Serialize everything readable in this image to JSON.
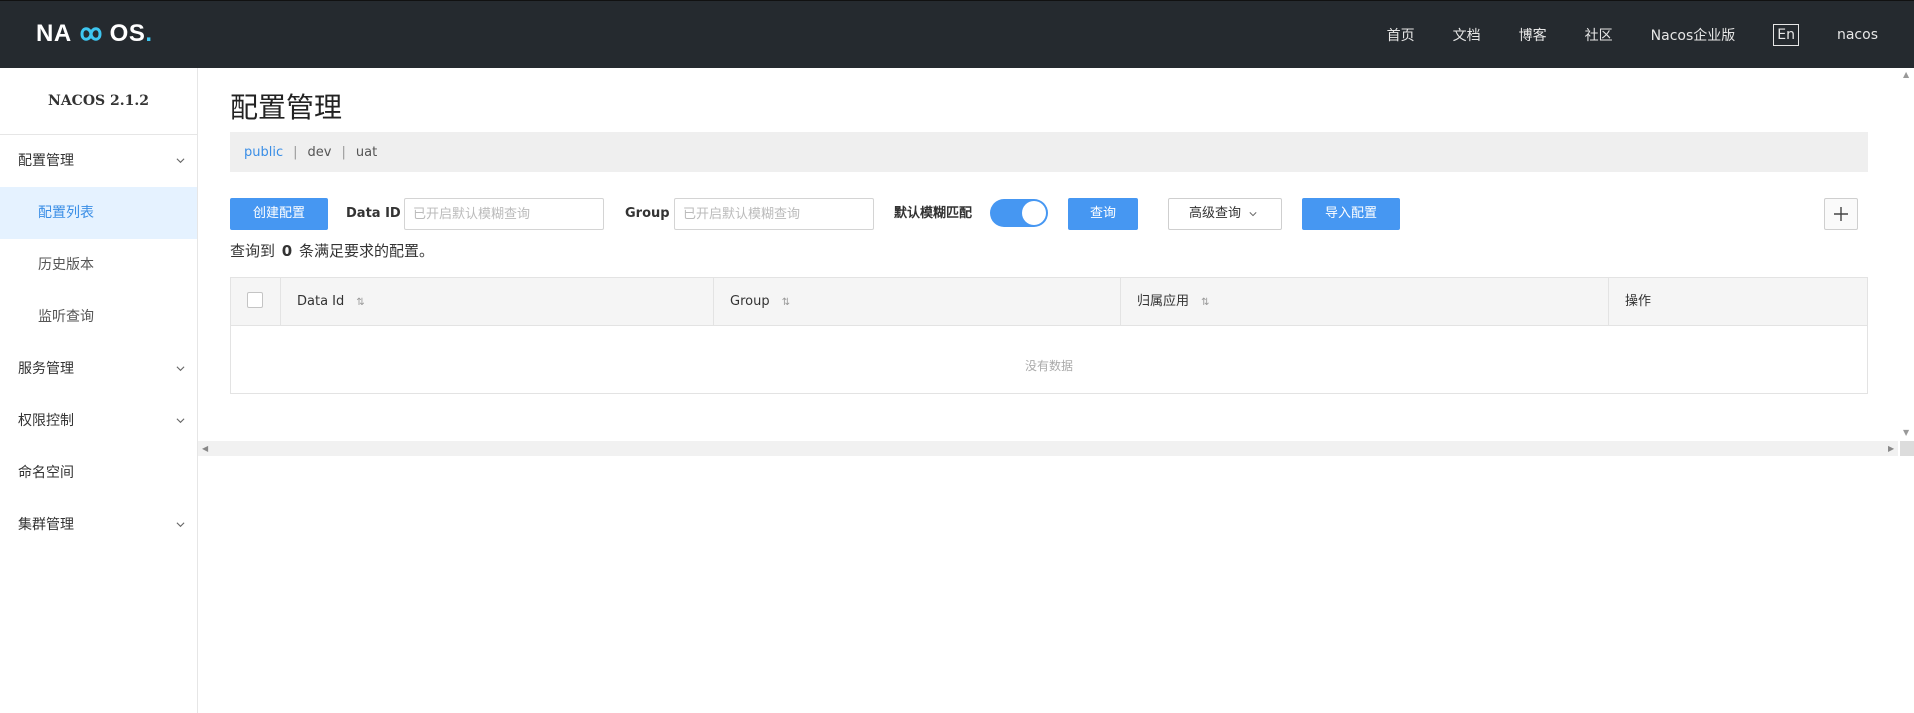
{
  "header": {
    "logo_text_left": "NA",
    "logo_text_right": "OS",
    "logo_dot": ".",
    "nav": [
      {
        "label": "首页"
      },
      {
        "label": "文档"
      },
      {
        "label": "博客"
      },
      {
        "label": "社区"
      },
      {
        "label": "Nacos企业版"
      }
    ],
    "lang": "En",
    "user": "nacos"
  },
  "sidebar": {
    "version": "NACOS 2.1.2",
    "groups": [
      {
        "label": "配置管理",
        "children": [
          {
            "label": "配置列表",
            "active": true
          },
          {
            "label": "历史版本"
          },
          {
            "label": "监听查询"
          }
        ]
      },
      {
        "label": "服务管理"
      },
      {
        "label": "权限控制"
      },
      {
        "label": "命名空间"
      },
      {
        "label": "集群管理"
      }
    ]
  },
  "main": {
    "title": "配置管理",
    "namespaces": [
      {
        "label": "public",
        "active": true
      },
      {
        "label": "dev"
      },
      {
        "label": "uat"
      }
    ],
    "namespace_separator": "|",
    "toolbar": {
      "create_button": "创建配置",
      "dataid_label": "Data ID",
      "dataid_placeholder": "已开启默认模糊查询",
      "group_label": "Group",
      "group_placeholder": "已开启默认模糊查询",
      "fuzzy_label": "默认模糊匹配",
      "fuzzy_enabled": true,
      "query_button": "查询",
      "advanced_button": "高级查询",
      "import_button": "导入配置"
    },
    "result": {
      "prefix": "查询到",
      "count": "0",
      "suffix": "条满足要求的配置。"
    },
    "table": {
      "columns": [
        "Data Id",
        "Group",
        "归属应用",
        "操作"
      ],
      "sort_glyph": "⇅",
      "empty": "没有数据"
    }
  },
  "colors": {
    "header_bg": "#252a2f",
    "primary": "#4697f2",
    "active_menu_bg": "#e5f2ff",
    "active_text": "#3a8ee6"
  }
}
